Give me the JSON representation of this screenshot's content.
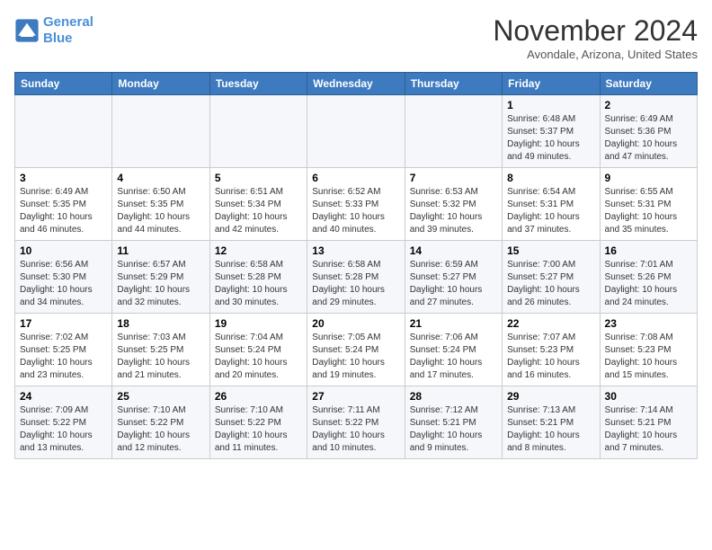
{
  "header": {
    "logo_line1": "General",
    "logo_line2": "Blue",
    "month": "November 2024",
    "location": "Avondale, Arizona, United States"
  },
  "weekdays": [
    "Sunday",
    "Monday",
    "Tuesday",
    "Wednesday",
    "Thursday",
    "Friday",
    "Saturday"
  ],
  "rows": [
    [
      {
        "day": "",
        "info": ""
      },
      {
        "day": "",
        "info": ""
      },
      {
        "day": "",
        "info": ""
      },
      {
        "day": "",
        "info": ""
      },
      {
        "day": "",
        "info": ""
      },
      {
        "day": "1",
        "info": "Sunrise: 6:48 AM\nSunset: 5:37 PM\nDaylight: 10 hours and 49 minutes."
      },
      {
        "day": "2",
        "info": "Sunrise: 6:49 AM\nSunset: 5:36 PM\nDaylight: 10 hours and 47 minutes."
      }
    ],
    [
      {
        "day": "3",
        "info": "Sunrise: 6:49 AM\nSunset: 5:35 PM\nDaylight: 10 hours and 46 minutes."
      },
      {
        "day": "4",
        "info": "Sunrise: 6:50 AM\nSunset: 5:35 PM\nDaylight: 10 hours and 44 minutes."
      },
      {
        "day": "5",
        "info": "Sunrise: 6:51 AM\nSunset: 5:34 PM\nDaylight: 10 hours and 42 minutes."
      },
      {
        "day": "6",
        "info": "Sunrise: 6:52 AM\nSunset: 5:33 PM\nDaylight: 10 hours and 40 minutes."
      },
      {
        "day": "7",
        "info": "Sunrise: 6:53 AM\nSunset: 5:32 PM\nDaylight: 10 hours and 39 minutes."
      },
      {
        "day": "8",
        "info": "Sunrise: 6:54 AM\nSunset: 5:31 PM\nDaylight: 10 hours and 37 minutes."
      },
      {
        "day": "9",
        "info": "Sunrise: 6:55 AM\nSunset: 5:31 PM\nDaylight: 10 hours and 35 minutes."
      }
    ],
    [
      {
        "day": "10",
        "info": "Sunrise: 6:56 AM\nSunset: 5:30 PM\nDaylight: 10 hours and 34 minutes."
      },
      {
        "day": "11",
        "info": "Sunrise: 6:57 AM\nSunset: 5:29 PM\nDaylight: 10 hours and 32 minutes."
      },
      {
        "day": "12",
        "info": "Sunrise: 6:58 AM\nSunset: 5:28 PM\nDaylight: 10 hours and 30 minutes."
      },
      {
        "day": "13",
        "info": "Sunrise: 6:58 AM\nSunset: 5:28 PM\nDaylight: 10 hours and 29 minutes."
      },
      {
        "day": "14",
        "info": "Sunrise: 6:59 AM\nSunset: 5:27 PM\nDaylight: 10 hours and 27 minutes."
      },
      {
        "day": "15",
        "info": "Sunrise: 7:00 AM\nSunset: 5:27 PM\nDaylight: 10 hours and 26 minutes."
      },
      {
        "day": "16",
        "info": "Sunrise: 7:01 AM\nSunset: 5:26 PM\nDaylight: 10 hours and 24 minutes."
      }
    ],
    [
      {
        "day": "17",
        "info": "Sunrise: 7:02 AM\nSunset: 5:25 PM\nDaylight: 10 hours and 23 minutes."
      },
      {
        "day": "18",
        "info": "Sunrise: 7:03 AM\nSunset: 5:25 PM\nDaylight: 10 hours and 21 minutes."
      },
      {
        "day": "19",
        "info": "Sunrise: 7:04 AM\nSunset: 5:24 PM\nDaylight: 10 hours and 20 minutes."
      },
      {
        "day": "20",
        "info": "Sunrise: 7:05 AM\nSunset: 5:24 PM\nDaylight: 10 hours and 19 minutes."
      },
      {
        "day": "21",
        "info": "Sunrise: 7:06 AM\nSunset: 5:24 PM\nDaylight: 10 hours and 17 minutes."
      },
      {
        "day": "22",
        "info": "Sunrise: 7:07 AM\nSunset: 5:23 PM\nDaylight: 10 hours and 16 minutes."
      },
      {
        "day": "23",
        "info": "Sunrise: 7:08 AM\nSunset: 5:23 PM\nDaylight: 10 hours and 15 minutes."
      }
    ],
    [
      {
        "day": "24",
        "info": "Sunrise: 7:09 AM\nSunset: 5:22 PM\nDaylight: 10 hours and 13 minutes."
      },
      {
        "day": "25",
        "info": "Sunrise: 7:10 AM\nSunset: 5:22 PM\nDaylight: 10 hours and 12 minutes."
      },
      {
        "day": "26",
        "info": "Sunrise: 7:10 AM\nSunset: 5:22 PM\nDaylight: 10 hours and 11 minutes."
      },
      {
        "day": "27",
        "info": "Sunrise: 7:11 AM\nSunset: 5:22 PM\nDaylight: 10 hours and 10 minutes."
      },
      {
        "day": "28",
        "info": "Sunrise: 7:12 AM\nSunset: 5:21 PM\nDaylight: 10 hours and 9 minutes."
      },
      {
        "day": "29",
        "info": "Sunrise: 7:13 AM\nSunset: 5:21 PM\nDaylight: 10 hours and 8 minutes."
      },
      {
        "day": "30",
        "info": "Sunrise: 7:14 AM\nSunset: 5:21 PM\nDaylight: 10 hours and 7 minutes."
      }
    ]
  ]
}
